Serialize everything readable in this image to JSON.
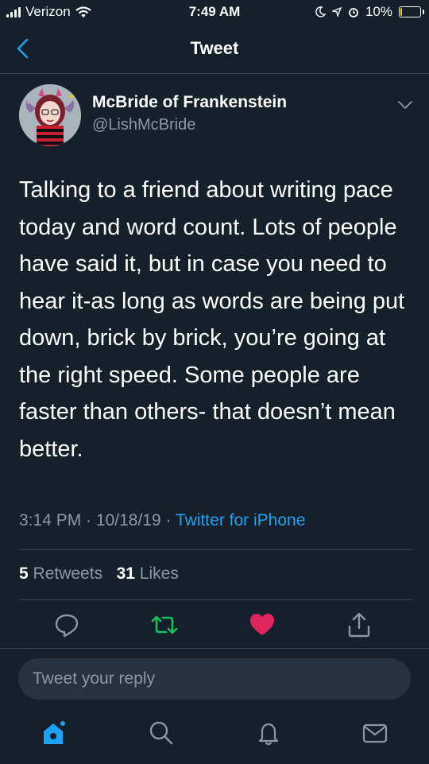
{
  "status_bar": {
    "carrier": "Verizon",
    "time": "7:49 AM",
    "battery": "10%",
    "battery_level": 0.1
  },
  "header": {
    "title": "Tweet",
    "back_icon": "chevron-left-icon"
  },
  "tweet": {
    "author_name": "McBride of Frankenstein",
    "author_handle": "@LishMcBride",
    "text": "Talking to a friend about writing pace today and word count. Lots of people have said it, but in case you need to hear it-as long as words are being put down, brick by brick, you’re going at the right speed. Some people are faster than others- that doesn’t mean better.",
    "time": "3:14 PM",
    "date": "10/18/19",
    "separator": "·",
    "source": "Twitter for iPhone",
    "retweets_count": "5",
    "retweets_label": "Retweets",
    "likes_count": "31",
    "likes_label": "Likes"
  },
  "actions": [
    {
      "name": "reply",
      "icon": "comment-icon"
    },
    {
      "name": "retweet",
      "icon": "retweet-icon",
      "color": "#17bf63"
    },
    {
      "name": "like",
      "icon": "heart-icon",
      "color": "#e0245e"
    },
    {
      "name": "share",
      "icon": "share-icon"
    }
  ],
  "reply": {
    "placeholder": "Tweet your reply"
  },
  "tab_bar": [
    {
      "name": "home",
      "icon": "home-icon",
      "active": true
    },
    {
      "name": "search",
      "icon": "search-icon"
    },
    {
      "name": "notifications",
      "icon": "bell-icon"
    },
    {
      "name": "messages",
      "icon": "mail-icon"
    }
  ],
  "colors": {
    "background": "#15202b",
    "accent": "#1da1f2",
    "secondary_text": "#8899a6",
    "divider": "#38444d"
  }
}
